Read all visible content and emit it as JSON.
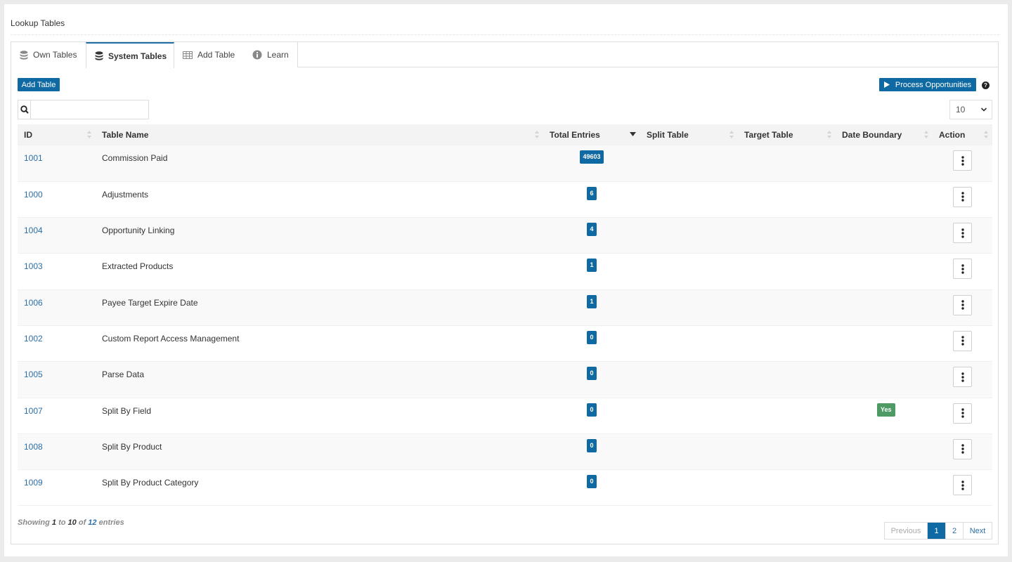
{
  "page": {
    "title": "Lookup Tables"
  },
  "tabs": [
    {
      "label": "Own Tables",
      "icon": "database-icon"
    },
    {
      "label": "System Tables",
      "icon": "database-icon"
    },
    {
      "label": "Add Table",
      "icon": "table-icon"
    },
    {
      "label": "Learn",
      "icon": "info-icon"
    }
  ],
  "toolbar": {
    "add_table_label": "Add Table",
    "process_label": "Process Opportunities",
    "help": "?"
  },
  "search": {
    "value": "",
    "placeholder": ""
  },
  "page_length": "10",
  "table": {
    "headers": {
      "id": "ID",
      "name": "Table Name",
      "total": "Total Entries",
      "split": "Split Table",
      "target": "Target Table",
      "date": "Date Boundary",
      "action": "Action"
    },
    "rows": [
      {
        "id": "1001",
        "name": "Commission Paid",
        "total": "49603",
        "split": "",
        "target": "",
        "date": ""
      },
      {
        "id": "1000",
        "name": "Adjustments",
        "total": "6",
        "split": "",
        "target": "",
        "date": ""
      },
      {
        "id": "1004",
        "name": "Opportunity Linking",
        "total": "4",
        "split": "",
        "target": "",
        "date": ""
      },
      {
        "id": "1003",
        "name": "Extracted Products",
        "total": "1",
        "split": "",
        "target": "",
        "date": ""
      },
      {
        "id": "1006",
        "name": "Payee Target Expire Date",
        "total": "1",
        "split": "",
        "target": "",
        "date": ""
      },
      {
        "id": "1002",
        "name": "Custom Report Access Management",
        "total": "0",
        "split": "",
        "target": "",
        "date": ""
      },
      {
        "id": "1005",
        "name": "Parse Data",
        "total": "0",
        "split": "",
        "target": "",
        "date": ""
      },
      {
        "id": "1007",
        "name": "Split By Field",
        "total": "0",
        "split": "",
        "target": "",
        "date": "Yes"
      },
      {
        "id": "1008",
        "name": "Split By Product",
        "total": "0",
        "split": "",
        "target": "",
        "date": ""
      },
      {
        "id": "1009",
        "name": "Split By Product Category",
        "total": "0",
        "split": "",
        "target": "",
        "date": ""
      }
    ]
  },
  "info": {
    "prefix": "Showing",
    "from": "1",
    "to_word": "to",
    "to": "10",
    "of_word": "of",
    "total": "12",
    "suffix": "entries"
  },
  "pagination": {
    "previous": "Previous",
    "pages": [
      "1",
      "2"
    ],
    "current": "1",
    "next": "Next"
  },
  "colors": {
    "primary": "#0f6aa3",
    "success": "#4e9a64",
    "link": "#2a6fa8"
  }
}
